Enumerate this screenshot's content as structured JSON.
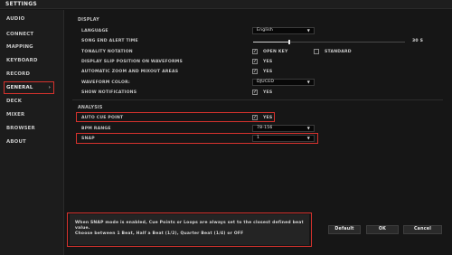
{
  "window": {
    "title": "SETTINGS"
  },
  "sidebar": {
    "items": [
      {
        "label": "AUDIO"
      },
      {
        "label": "CONNECT"
      },
      {
        "label": "MAPPING"
      },
      {
        "label": "KEYBOARD"
      },
      {
        "label": "RECORD"
      },
      {
        "label": "GENERAL",
        "active": true,
        "chevron": "›"
      },
      {
        "label": "DECK"
      },
      {
        "label": "MIXER"
      },
      {
        "label": "BROWSER"
      },
      {
        "label": "ABOUT"
      }
    ]
  },
  "display": {
    "section_title": "DISPLAY",
    "language_label": "LANGUAGE",
    "language_value": "English",
    "song_end_alert_label": "SONG END ALERT TIME",
    "song_end_alert_value": "30 S",
    "song_end_alert_fraction": 0.24,
    "tonality_label": "TONALITY NOTATION",
    "open_key_label": "OPEN KEY",
    "open_key_checked": true,
    "standard_label": "STANDARD",
    "standard_checked": false,
    "slip_label": "DISPLAY SLIP POSITION ON WAVEFORMS",
    "slip_value": "YES",
    "zoom_label": "AUTOMATIC ZOOM AND MIXOUT AREAS",
    "zoom_value": "YES",
    "waveform_color_label": "WAVEFORM COLOR:",
    "waveform_color_value": "DJUCED",
    "notifications_label": "SHOW NOTIFICATIONS",
    "notifications_value": "YES"
  },
  "analysis": {
    "section_title": "ANALYSIS",
    "auto_cue_label": "AUTO CUE POINT",
    "auto_cue_value": "YES",
    "bpm_range_label": "BPM RANGE",
    "bpm_range_value": "78-156",
    "snap_label": "SNAP",
    "snap_value": "1"
  },
  "info": {
    "line1": "When SNAP mode is enabled, Cue Points or Loops are always set to the closest defined beat",
    "line2": "value.",
    "line3": "Choose between 1 Beat, Half a Beat (1/2), Quarter Beat (1/4) or OFF"
  },
  "buttons": {
    "default": "Default",
    "ok": "OK",
    "cancel": "Cancel"
  },
  "glyphs": {
    "check": "✓",
    "dropdown_arrow": "▼"
  },
  "colors": {
    "highlight": "#d6322d",
    "background": "#161616"
  }
}
